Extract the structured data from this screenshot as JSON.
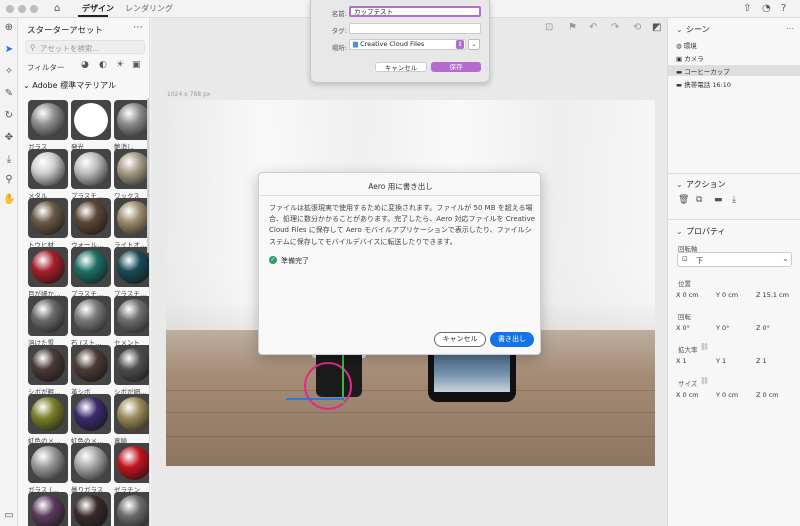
{
  "topbar": {
    "tabs": [
      {
        "label": "デザイン"
      },
      {
        "label": "レンダリング"
      }
    ]
  },
  "left_panel": {
    "title": "スターターアセット",
    "search_placeholder": "アセットを検索...",
    "filter_label": "フィルター",
    "section_label": "Adobe 標準マテリアル",
    "materials": [
      {
        "label": "ガラス",
        "color": "#8f8f8f"
      },
      {
        "label": "発光",
        "color": "#ffffff"
      },
      {
        "label": "艶消し",
        "color": "#8a8a8a"
      },
      {
        "label": "メタル",
        "color": "#cfcfcf"
      },
      {
        "label": "プラスチ…",
        "color": "#bdbdbd"
      },
      {
        "label": "ワックス",
        "color": "#a39a82"
      },
      {
        "label": "トウヒ材",
        "color": "#6a5a45"
      },
      {
        "label": "ウォール…",
        "color": "#5d4636"
      },
      {
        "label": "ライトオ…",
        "color": "#9c8a6c"
      },
      {
        "label": "目が細か…",
        "color": "#a51f2b"
      },
      {
        "label": "プラスチ…",
        "color": "#1d6f66"
      },
      {
        "label": "プラスチ…",
        "color": "#194a57"
      },
      {
        "label": "溶けた雪",
        "color": "#6a6a6a"
      },
      {
        "label": "石 (スト…",
        "color": "#7a7a7a"
      },
      {
        "label": "セメント",
        "color": "#6f6f6f"
      },
      {
        "label": "シボが粗…",
        "color": "#4a3a36"
      },
      {
        "label": "革シボ",
        "color": "#4d3b35"
      },
      {
        "label": "シボが細…",
        "color": "#4f4f4f"
      },
      {
        "label": "虹色のメ…",
        "color": "#7a7f2a"
      },
      {
        "label": "虹色のメ…",
        "color": "#3c2a6d"
      },
      {
        "label": "真鍮",
        "color": "#9a8a5a"
      },
      {
        "label": "ガラス (…",
        "color": "#9a9a9a"
      },
      {
        "label": "曇りガラス",
        "color": "#a8a8a8"
      },
      {
        "label": "ゼラチン",
        "color": "#c0141e"
      },
      {
        "label": "",
        "color": "#5a3a5a"
      },
      {
        "label": "",
        "color": "#3a2a2a"
      },
      {
        "label": "",
        "color": "#6a6a6a"
      }
    ]
  },
  "canvas": {
    "size_label": "1024 x 768 px"
  },
  "save_dialog": {
    "name_label": "名前:",
    "name_value": "カップテスト",
    "tag_label": "タグ:",
    "tag_value": "",
    "location_label": "場所:",
    "location_value": "Creative Cloud Files",
    "cancel_label": "キャンセル",
    "save_label": "保存"
  },
  "export_modal": {
    "title": "Aero 用に書き出し",
    "body": "ファイルは拡張現実で使用するために変換されます。ファイルが 50 MB を超える場合、処理に数分かかることがあります。完了したら、Aero 対応ファイルを Creative Cloud Files に保存して Aero モバイルアプリケーションで表示したり、ファイルシステムに保存してモバイルデバイスに転送したりできます。",
    "status": "準備完了",
    "cancel_label": "キャンセル",
    "export_label": "書き出し"
  },
  "right_panel": {
    "scene_title": "シーン",
    "scene_items": [
      {
        "label": "環境"
      },
      {
        "label": "カメラ"
      },
      {
        "label": "コーヒーカップ"
      },
      {
        "label": "携帯電話 16:10"
      }
    ],
    "actions_title": "アクション",
    "properties_title": "プロパティ",
    "rotation_axis_label": "回転軸",
    "rotation_axis_value": "下",
    "position_label": "位置",
    "position": {
      "x": "X 0 cm",
      "y": "Y 0 cm",
      "z": "Z 15.1 cm"
    },
    "rotation_label": "回転",
    "rotation": {
      "x": "X 0°",
      "y": "Y 0°",
      "z": "Z 0°"
    },
    "scale_label": "拡大率",
    "scale": {
      "x": "X 1",
      "y": "Y 1",
      "z": "Z 1"
    },
    "size_label": "サイズ",
    "size": {
      "x": "X 0 cm",
      "y": "Y 0 cm",
      "z": "Z 0 cm"
    }
  },
  "colors": {
    "accent": "#1473e6",
    "save": "#b66bd1",
    "ready": "#2d9d6a",
    "gizmo_pink": "#e22a8a"
  }
}
